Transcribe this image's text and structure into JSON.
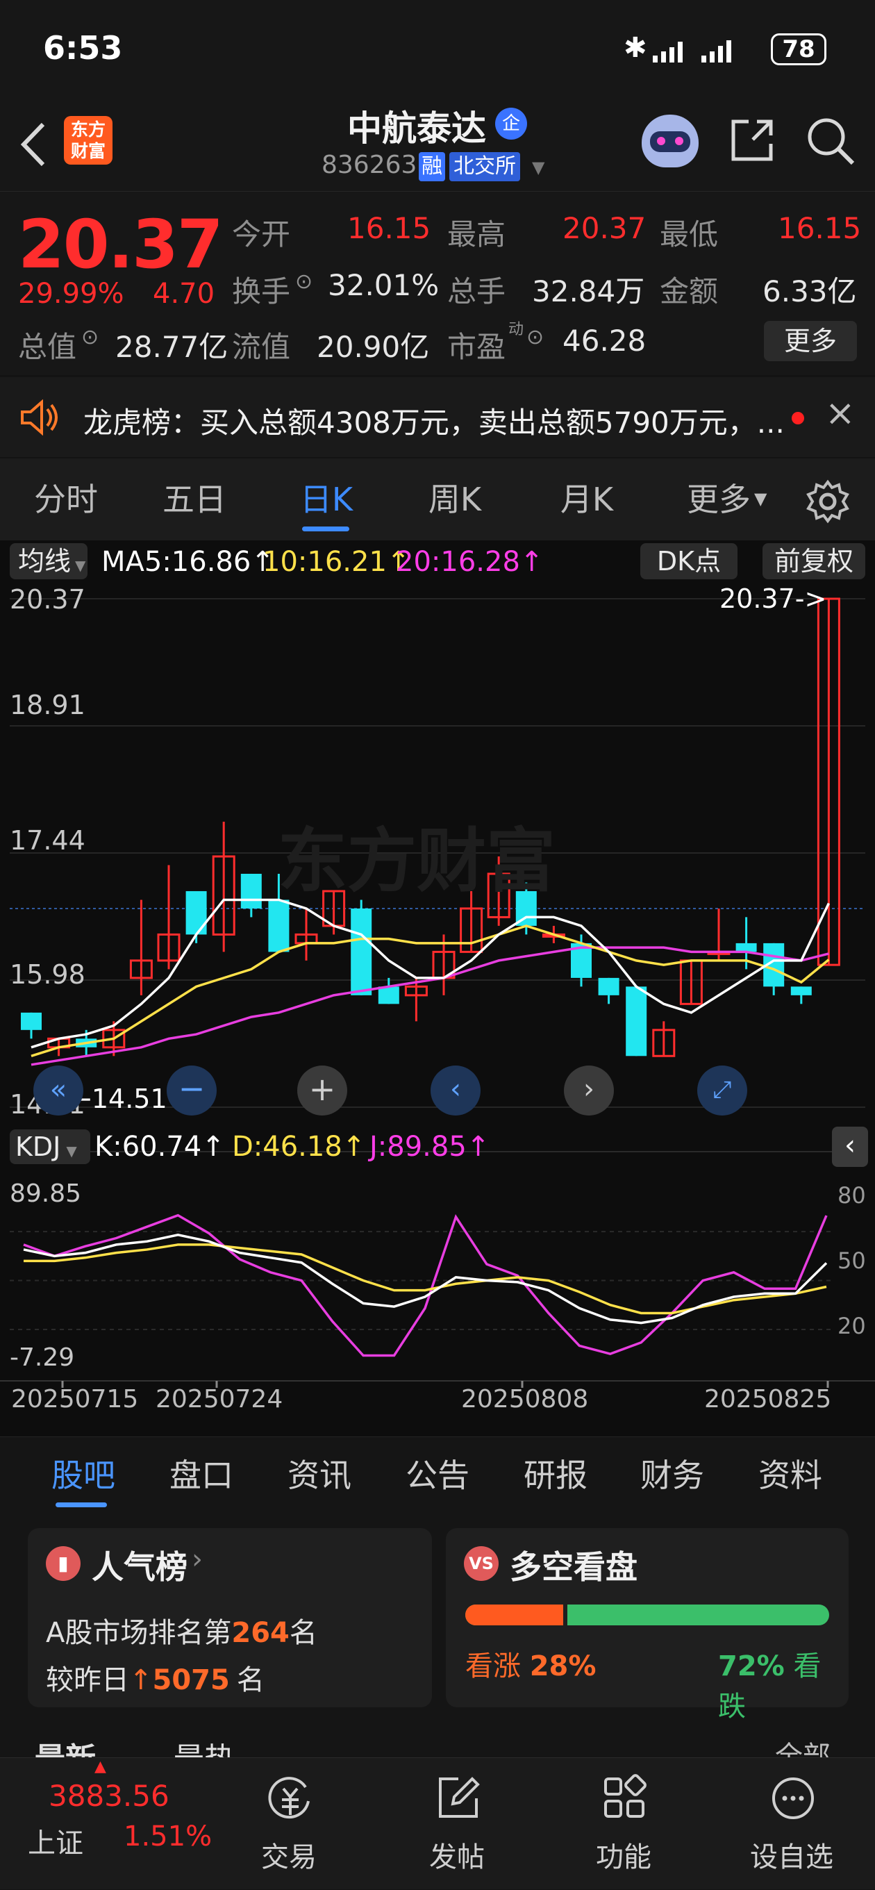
{
  "status": {
    "time": "6:53",
    "battery": "78"
  },
  "header": {
    "logo_line1": "东方",
    "logo_line2": "财富",
    "stock_name": "中航泰达",
    "badge": "企",
    "code": "836263",
    "rong": "融",
    "exchange": "北交所"
  },
  "quote": {
    "price": "20.37",
    "pct": "29.99%",
    "change": "4.70",
    "row1": [
      {
        "label": "今开",
        "value": "16.15"
      },
      {
        "label": "最高",
        "value": "20.37"
      },
      {
        "label": "最低",
        "value": "16.15"
      }
    ],
    "row2": [
      {
        "label": "换手",
        "value": "32.01%"
      },
      {
        "label": "总手",
        "value": "32.84万"
      },
      {
        "label": "金额",
        "value": "6.33亿"
      }
    ],
    "row3": [
      {
        "label": "总值",
        "value": "28.77亿"
      },
      {
        "label": "流值",
        "value": "20.90亿"
      },
      {
        "label": "市盈",
        "sup": "动",
        "value": "46.28"
      }
    ],
    "more": "更多"
  },
  "notice": {
    "text": "龙虎榜：买入总额4308万元，卖出总额5790万元，..."
  },
  "tabs": {
    "items": [
      "分时",
      "五日",
      "日K",
      "周K",
      "月K",
      "更多"
    ],
    "active": 2
  },
  "chart": {
    "ma_selector": "均线",
    "ma5": "MA5:16.86↑",
    "ma10": "10:16.21↑",
    "ma20": "20:16.28↑",
    "dk": "DK点",
    "fq": "前复权",
    "ylabels": [
      "20.37",
      "18.91",
      "17.44",
      "15.98",
      "14.51"
    ],
    "last_price_tag": "20.37->",
    "low_tag": "←14.51",
    "watermark": "东方财富",
    "kdj_selector": "KDJ",
    "k": "K:60.74↑",
    "d": "D:46.18↑",
    "j": "J:89.85↑",
    "kdj_left": [
      "89.85",
      "-7.29"
    ],
    "kdj_right": [
      "80",
      "50",
      "20"
    ],
    "dates": [
      "20250715",
      "20250724",
      "20250808",
      "20250825"
    ],
    "colors": {
      "up": "#ff2d2d",
      "down": "#22e6f0",
      "ma5": "#ffffff",
      "ma10": "#ffe14a",
      "ma20": "#e83ee0"
    }
  },
  "chart_data": {
    "type": "candlestick",
    "ylim": [
      14.51,
      20.37
    ],
    "candles": [
      {
        "o": 15.6,
        "c": 15.4,
        "h": 15.6,
        "l": 15.3
      },
      {
        "o": 15.2,
        "c": 15.3,
        "h": 15.3,
        "l": 15.1
      },
      {
        "o": 15.3,
        "c": 15.2,
        "h": 15.4,
        "l": 15.1
      },
      {
        "o": 15.2,
        "c": 15.4,
        "h": 15.5,
        "l": 15.1
      },
      {
        "o": 16.0,
        "c": 16.2,
        "h": 16.9,
        "l": 15.8
      },
      {
        "o": 16.2,
        "c": 16.5,
        "h": 17.3,
        "l": 16.1
      },
      {
        "o": 17.0,
        "c": 16.5,
        "h": 17.0,
        "l": 16.4
      },
      {
        "o": 16.5,
        "c": 17.4,
        "h": 17.8,
        "l": 16.3
      },
      {
        "o": 17.2,
        "c": 16.8,
        "h": 17.2,
        "l": 16.7
      },
      {
        "o": 16.9,
        "c": 16.3,
        "h": 17.2,
        "l": 16.3
      },
      {
        "o": 16.4,
        "c": 16.5,
        "h": 16.8,
        "l": 16.2
      },
      {
        "o": 16.6,
        "c": 17.0,
        "h": 17.0,
        "l": 16.5
      },
      {
        "o": 16.8,
        "c": 15.8,
        "h": 16.9,
        "l": 15.8
      },
      {
        "o": 15.9,
        "c": 15.7,
        "h": 16.0,
        "l": 15.7
      },
      {
        "o": 15.8,
        "c": 15.9,
        "h": 16.0,
        "l": 15.5
      },
      {
        "o": 16.0,
        "c": 16.3,
        "h": 16.5,
        "l": 15.8
      },
      {
        "o": 16.3,
        "c": 16.8,
        "h": 17.0,
        "l": 16.3
      },
      {
        "o": 16.7,
        "c": 17.2,
        "h": 17.4,
        "l": 16.6
      },
      {
        "o": 17.0,
        "c": 16.6,
        "h": 17.1,
        "l": 16.5
      },
      {
        "o": 16.5,
        "c": 16.5,
        "h": 16.6,
        "l": 16.4
      },
      {
        "o": 16.4,
        "c": 16.0,
        "h": 16.5,
        "l": 15.9
      },
      {
        "o": 16.0,
        "c": 15.8,
        "h": 16.0,
        "l": 15.7
      },
      {
        "o": 15.9,
        "c": 15.1,
        "h": 15.9,
        "l": 15.1
      },
      {
        "o": 15.1,
        "c": 15.4,
        "h": 15.5,
        "l": 15.1
      },
      {
        "o": 15.7,
        "c": 16.2,
        "h": 16.2,
        "l": 15.7
      },
      {
        "o": 16.3,
        "c": 16.3,
        "h": 16.8,
        "l": 16.2
      },
      {
        "o": 16.4,
        "c": 16.3,
        "h": 16.7,
        "l": 16.1
      },
      {
        "o": 16.4,
        "c": 15.9,
        "h": 16.4,
        "l": 15.8
      },
      {
        "o": 15.9,
        "c": 15.8,
        "h": 15.9,
        "l": 15.7
      },
      {
        "o": 16.15,
        "c": 20.37,
        "h": 20.37,
        "l": 16.15
      }
    ],
    "ma5": [
      15.2,
      15.3,
      15.35,
      15.45,
      15.7,
      16.0,
      16.5,
      16.9,
      16.9,
      16.9,
      16.8,
      16.6,
      16.5,
      16.2,
      16.0,
      16.0,
      16.2,
      16.5,
      16.7,
      16.7,
      16.6,
      16.3,
      15.9,
      15.7,
      15.6,
      15.8,
      16.0,
      16.2,
      16.2,
      16.86
    ],
    "ma10": [
      15.1,
      15.2,
      15.25,
      15.3,
      15.5,
      15.7,
      15.9,
      16.0,
      16.1,
      16.3,
      16.4,
      16.4,
      16.45,
      16.45,
      16.4,
      16.4,
      16.4,
      16.5,
      16.6,
      16.5,
      16.4,
      16.3,
      16.2,
      16.15,
      16.2,
      16.2,
      16.2,
      16.1,
      15.95,
      16.21
    ],
    "ma20": [
      15.0,
      15.05,
      15.1,
      15.15,
      15.2,
      15.3,
      15.35,
      15.45,
      15.55,
      15.6,
      15.7,
      15.8,
      15.85,
      15.9,
      15.95,
      16.0,
      16.1,
      16.2,
      16.25,
      16.3,
      16.35,
      16.35,
      16.35,
      16.35,
      16.3,
      16.3,
      16.3,
      16.25,
      16.2,
      16.28
    ],
    "kdj": {
      "ylim": [
        -7.29,
        89.85
      ],
      "k": [
        69,
        65,
        67,
        72,
        74,
        78,
        74,
        67,
        64,
        61,
        48,
        36,
        34,
        40,
        52,
        50,
        49,
        44,
        33,
        26,
        24,
        27,
        35,
        40,
        42,
        42,
        60.74
      ],
      "d": [
        62,
        62,
        64,
        67,
        69,
        72,
        72,
        70,
        68,
        66,
        58,
        50,
        44,
        44,
        48,
        50,
        52,
        50,
        43,
        35,
        30,
        30,
        34,
        38,
        40,
        42,
        46.18
      ],
      "j": [
        72,
        65,
        71,
        76,
        83,
        90,
        79,
        63,
        55,
        50,
        25,
        4,
        4,
        33,
        89,
        60,
        53,
        30,
        10,
        5,
        12,
        30,
        50,
        55,
        45,
        45,
        89.85
      ]
    }
  },
  "subtabs": {
    "items": [
      "股吧",
      "盘口",
      "资讯",
      "公告",
      "研报",
      "财务",
      "资料"
    ],
    "active": 0
  },
  "card1": {
    "title": "人气榜",
    "line1_prefix": "A股市场排名第",
    "rank": "264",
    "line1_suffix": "名",
    "line2_prefix": "较昨日",
    "delta": "5075",
    "line2_suffix": "名"
  },
  "card2": {
    "title": "多空看盘",
    "up_label": "看涨",
    "up_pct": "28%",
    "down_pct": "72%",
    "down_label": "看跌",
    "up_ratio": 0.28
  },
  "feed": {
    "latest": "最新",
    "hot": "最热",
    "all": "全部"
  },
  "bottom": {
    "index_value": "3883.56",
    "index_name": "上证",
    "index_pct": "1.51%",
    "items": [
      "交易",
      "发帖",
      "功能",
      "设自选"
    ]
  }
}
